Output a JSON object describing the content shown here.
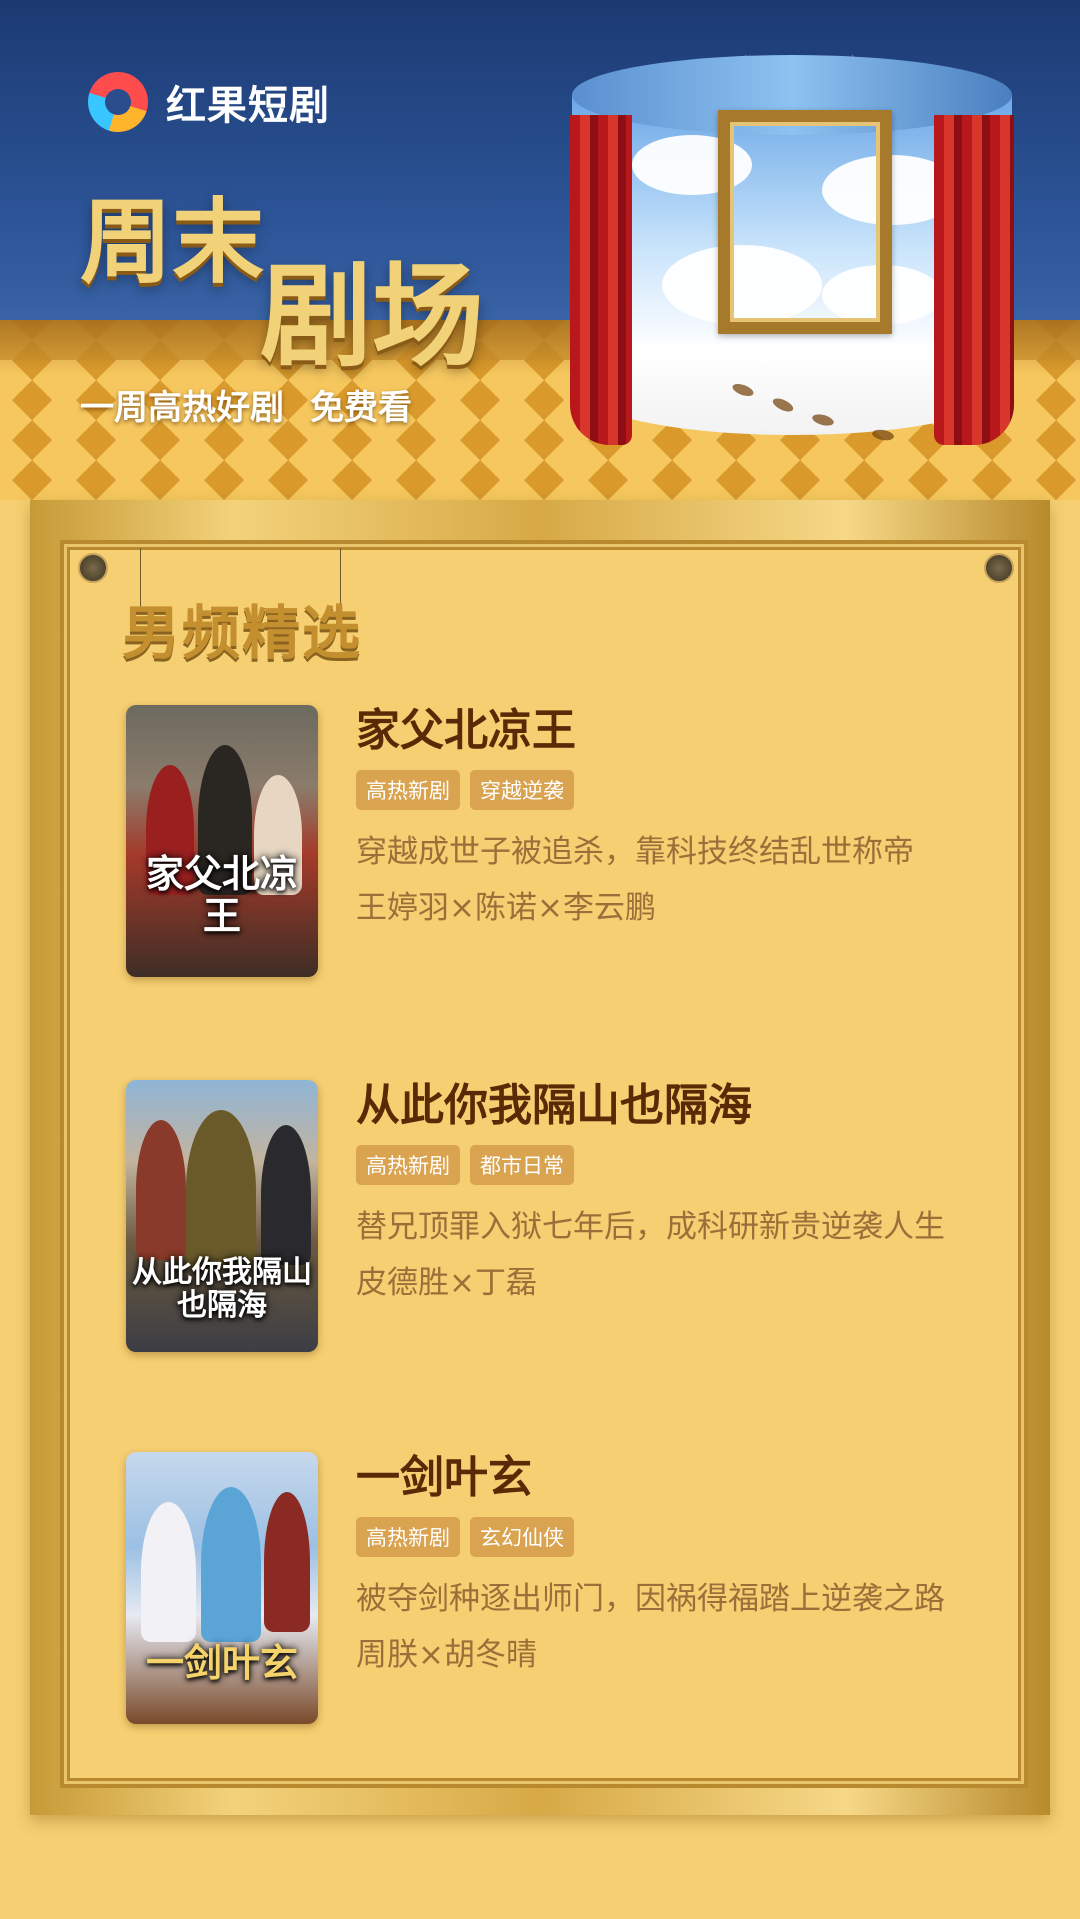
{
  "brand": {
    "name": "红果短剧"
  },
  "banner": {
    "headline_a": "周末",
    "headline_b": "剧场",
    "subtitle_a": "一周高热好剧",
    "subtitle_b": "免费看"
  },
  "section": {
    "title": "男频精选"
  },
  "dramas": [
    {
      "poster_text": "家父北凉王",
      "title": "家父北凉王",
      "tags": [
        "高热新剧",
        "穿越逆袭"
      ],
      "desc": "穿越成世子被追杀，靠科技终结乱世称帝",
      "cast": "王婷羽×陈诺×李云鹏"
    },
    {
      "poster_text": "从此你我隔山也隔海",
      "title": "从此你我隔山也隔海",
      "tags": [
        "高热新剧",
        "都市日常"
      ],
      "desc": "替兄顶罪入狱七年后，成科研新贵逆袭人生",
      "cast": "皮德胜×丁磊"
    },
    {
      "poster_text": "一剑叶玄",
      "title": "一剑叶玄",
      "tags": [
        "高热新剧",
        "玄幻仙侠"
      ],
      "desc": "被夺剑种逐出师门，因祸得福踏上逆袭之路",
      "cast": "周朕×胡冬晴"
    }
  ]
}
